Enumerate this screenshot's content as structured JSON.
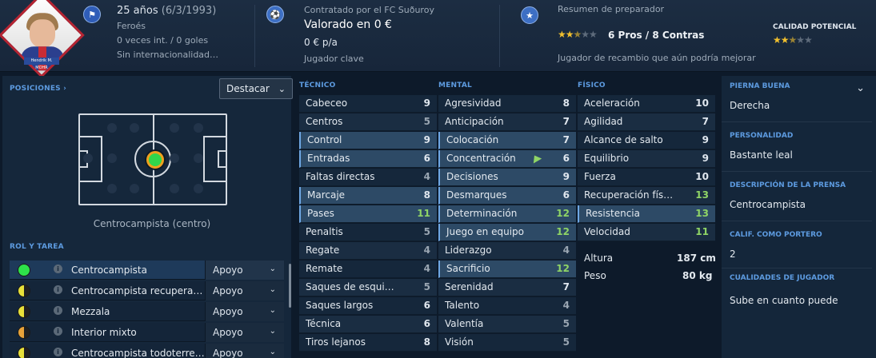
{
  "header": {
    "age": "25 años",
    "dob": "(6/3/1993)",
    "nationality": "Feroés",
    "intl": "0 veces int. / 0 goles",
    "intl_status": "Sin internacionalidad…",
    "contract": "Contratado por el FC Suðuroy",
    "value": "Valorado en 0 €",
    "wage": "0 € p/a",
    "squad_status": "Jugador clave",
    "coach_title": "Resumen de preparador",
    "pros_cons": "6 Pros / 8 Contras",
    "coach_verdict": "Jugador de recambio que aún podría mejorar",
    "potential_label": "CALIDAD POTENCIAL",
    "portrait_name": "Hendrik M. MOHR",
    "current_stars": 2.5,
    "potential_stars": 2.5
  },
  "left": {
    "positions_title": "POSICIONES ›",
    "highlight_select": "Destacar",
    "position_label": "Centrocampista (centro)",
    "roles_title": "ROL Y TAREA",
    "roles": [
      {
        "name": "Centrocampista",
        "duty": "Apoyo",
        "rating": "full"
      },
      {
        "name": "Centrocampista recupera…",
        "duty": "Apoyo",
        "rating": "half"
      },
      {
        "name": "Mezzala",
        "duty": "Apoyo",
        "rating": "half"
      },
      {
        "name": "Interior mixto",
        "duty": "Apoyo",
        "rating": "half"
      },
      {
        "name": "Centrocampista todoterre…",
        "duty": "Apoyo",
        "rating": "half"
      }
    ]
  },
  "technical": {
    "title": "TÉCNICO",
    "attrs": [
      {
        "name": "Cabeceo",
        "value": "9"
      },
      {
        "name": "Centros",
        "value": "5"
      },
      {
        "name": "Control",
        "value": "9"
      },
      {
        "name": "Entradas",
        "value": "6"
      },
      {
        "name": "Faltas directas",
        "value": "4"
      },
      {
        "name": "Marcaje",
        "value": "8"
      },
      {
        "name": "Pases",
        "value": "11"
      },
      {
        "name": "Penaltis",
        "value": "5"
      },
      {
        "name": "Regate",
        "value": "4"
      },
      {
        "name": "Remate",
        "value": "4"
      },
      {
        "name": "Saques de esqui…",
        "value": "5"
      },
      {
        "name": "Saques largos",
        "value": "6"
      },
      {
        "name": "Técnica",
        "value": "6"
      },
      {
        "name": "Tiros lejanos",
        "value": "8"
      }
    ]
  },
  "mental": {
    "title": "MENTAL",
    "attrs": [
      {
        "name": "Agresividad",
        "value": "8"
      },
      {
        "name": "Anticipación",
        "value": "7"
      },
      {
        "name": "Colocación",
        "value": "7"
      },
      {
        "name": "Concentración",
        "value": "6"
      },
      {
        "name": "Decisiones",
        "value": "9"
      },
      {
        "name": "Desmarques",
        "value": "6"
      },
      {
        "name": "Determinación",
        "value": "12"
      },
      {
        "name": "Juego en equipo",
        "value": "12"
      },
      {
        "name": "Liderazgo",
        "value": "4"
      },
      {
        "name": "Sacrificio",
        "value": "12"
      },
      {
        "name": "Serenidad",
        "value": "7"
      },
      {
        "name": "Talento",
        "value": "4"
      },
      {
        "name": "Valentía",
        "value": "5"
      },
      {
        "name": "Visión",
        "value": "5"
      }
    ]
  },
  "physical": {
    "title": "FÍSICO",
    "attrs": [
      {
        "name": "Aceleración",
        "value": "10"
      },
      {
        "name": "Agilidad",
        "value": "7"
      },
      {
        "name": "Alcance de salto",
        "value": "9"
      },
      {
        "name": "Equilibrio",
        "value": "9"
      },
      {
        "name": "Fuerza",
        "value": "10"
      },
      {
        "name": "Recuperación fís…",
        "value": "13"
      },
      {
        "name": "Resistencia",
        "value": "13"
      },
      {
        "name": "Velocidad",
        "value": "11"
      }
    ],
    "height_label": "Altura",
    "height_value": "187 cm",
    "weight_label": "Peso",
    "weight_value": "80 kg"
  },
  "right": {
    "foot_title": "PIERNA BUENA",
    "foot_value": "Derecha",
    "personality_title": "PERSONALIDAD",
    "personality_value": "Bastante leal",
    "press_title": "DESCRIPCIÓN DE LA PRENSA",
    "press_value": "Centrocampista",
    "gk_title": "CALIF. COMO PORTERO",
    "gk_value": "2",
    "traits_title": "CUALIDADES DE JUGADOR",
    "traits_value": "Sube en cuanto puede"
  },
  "colors": {
    "accent": "#5d9be0",
    "high_value": "#8fd466",
    "star": "#f2c02e"
  }
}
